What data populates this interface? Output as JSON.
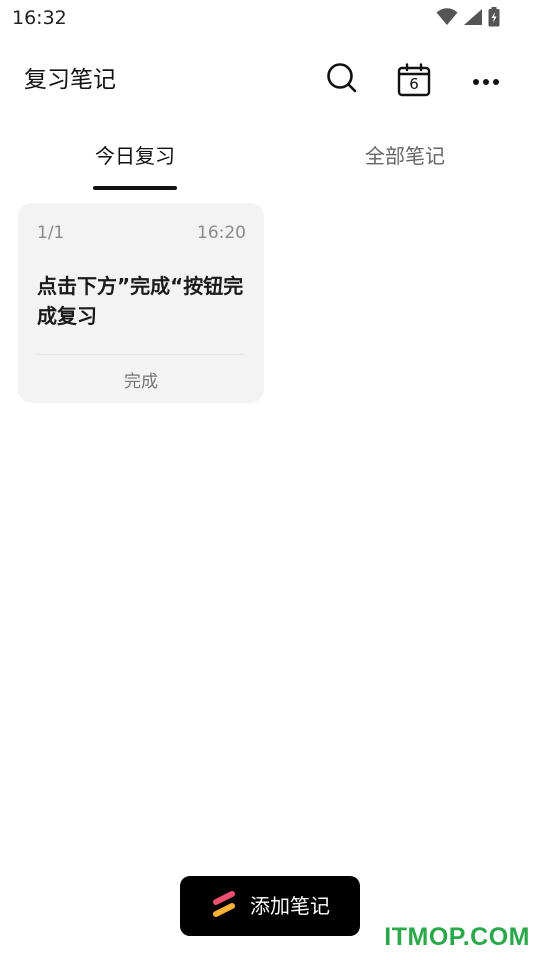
{
  "status_bar": {
    "time": "16:32",
    "icons": [
      "wifi-icon",
      "cellular-signal-icon",
      "battery-charging-icon"
    ]
  },
  "app_bar": {
    "title": "复习笔记",
    "actions": [
      "search-icon",
      "calendar-icon",
      "more-icon"
    ],
    "calendar_day": "6"
  },
  "tabs": [
    {
      "label": "今日复习",
      "active": true
    },
    {
      "label": "全部笔记",
      "active": false
    }
  ],
  "note_card": {
    "index": "1/1",
    "time": "16:20",
    "text": "点击下方”完成“按钮完成复习",
    "done_label": "完成"
  },
  "add_button": {
    "label": "添加笔记",
    "icon": "brand-stripes-icon"
  },
  "watermark": "ITMOP.COM",
  "colors": {
    "background": "#ffffff",
    "card_background": "#f3f3f3",
    "primary_text": "#111111",
    "secondary_text": "#8a8a8a",
    "button_background": "#000000",
    "icon_stripe_red": "#f0506e",
    "icon_stripe_yellow": "#f9b233",
    "watermark": "#2aa84a"
  }
}
